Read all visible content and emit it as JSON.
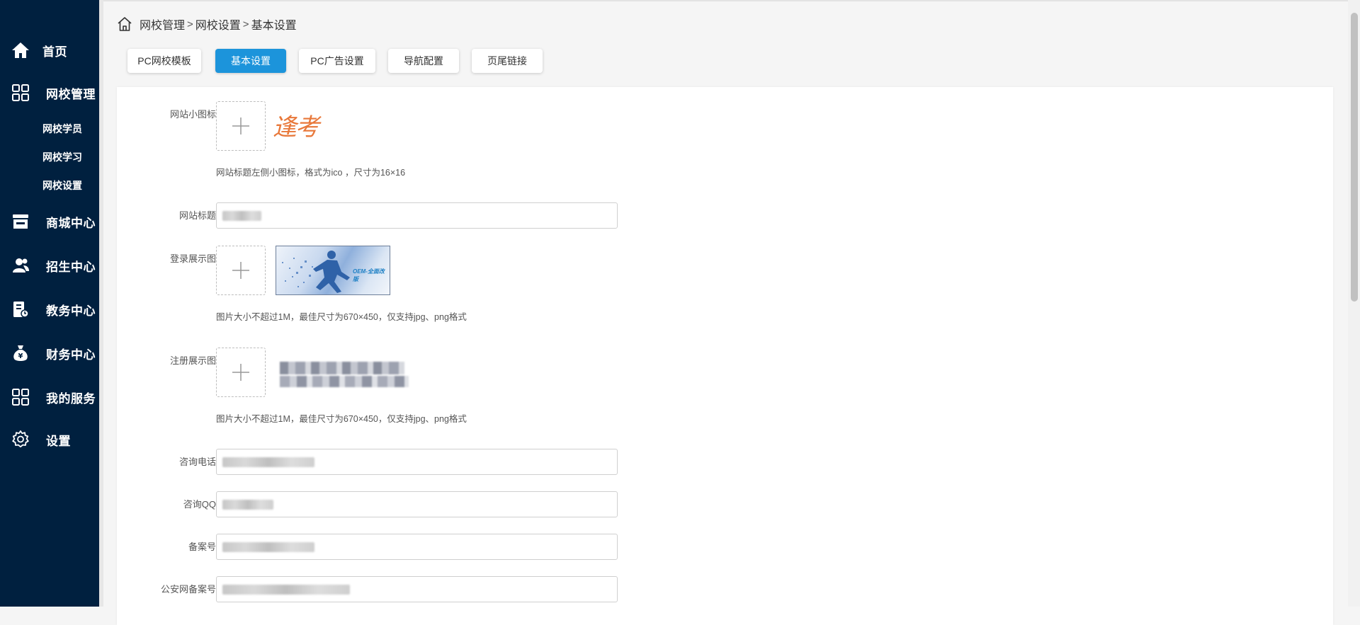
{
  "sidebar": {
    "items": [
      {
        "label": "首页",
        "icon": "home-icon"
      },
      {
        "label": "网校管理",
        "icon": "grid-icon"
      },
      {
        "label": "商城中心",
        "icon": "store-icon"
      },
      {
        "label": "招生中心",
        "icon": "users-icon"
      },
      {
        "label": "教务中心",
        "icon": "clipboard-icon"
      },
      {
        "label": "财务中心",
        "icon": "money-bag-icon"
      },
      {
        "label": "我的服务",
        "icon": "grid-icon"
      },
      {
        "label": "设置",
        "icon": "gear-icon"
      }
    ],
    "subitems": [
      "网校学员",
      "网校学习",
      "网校设置"
    ]
  },
  "breadcrumb": {
    "items": [
      "网校管理",
      "网校设置",
      "基本设置"
    ],
    "separator": ">"
  },
  "tabs": [
    {
      "label": "PC网校模板",
      "active": false
    },
    {
      "label": "基本设置",
      "active": true
    },
    {
      "label": "PC广告设置",
      "active": false
    },
    {
      "label": "导航配置",
      "active": false
    },
    {
      "label": "页尾链接",
      "active": false
    }
  ],
  "form": {
    "favicon": {
      "label": "网站小图标",
      "hint": "网站标题左侧小图标，格式为ico ，尺寸为16×16",
      "preview_text": "逢考"
    },
    "site_title": {
      "label": "网站标题"
    },
    "login_image": {
      "label": "登录展示图",
      "hint": "图片大小不超过1M，最佳尺寸为670×450，仅支持jpg、png格式",
      "preview_text": "OEM-全面改版"
    },
    "register_image": {
      "label": "注册展示图",
      "hint": "图片大小不超过1M，最佳尺寸为670×450，仅支持jpg、png格式"
    },
    "phone": {
      "label": "咨询电话"
    },
    "qq": {
      "label": "咨询QQ"
    },
    "icp": {
      "label": "备案号"
    },
    "police": {
      "label": "公安网备案号"
    }
  },
  "colors": {
    "sidebar_bg": "#00203f",
    "accent": "#1c94db"
  }
}
